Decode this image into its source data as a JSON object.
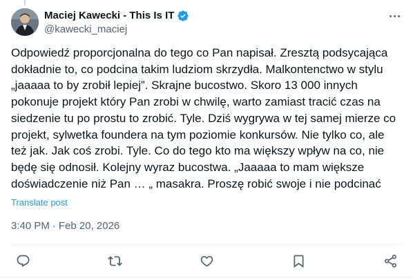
{
  "author": {
    "display_name": "Maciej Kawecki - This Is IT",
    "handle": "@kawecki_maciej",
    "verified": true
  },
  "post": {
    "text": "Odpowiedź proporcjonalna do tego co Pan napisał. Zresztą podsycająca dokładnie to, co podcina takim ludziom skrzydła. Malkontenctwo w stylu „jaaaaa to by zrobił lepiej”. Skrajne bucostwo.  Skoro 13 000 innych pokonuje projekt który Pan zrobi w chwilę, warto zamiast tracić czas na siedzenie tu po prostu to zrobić. Tyle. Dziś wygrywa w tej samej mierze co projekt, sylwetka foundera na tym poziomie konkursów. Nie tylko co, ale też jak. Jak coś zrobi. Tyle. Co do tego kto ma większy wpływ na co, nie będę się odnosił. Kolejny wyraz bucostwa. „Jaaaaa to mam większe doświadczenie niż Pan … „ masakra. Proszę robić swoje i nie podcinać",
    "translate_label": "Translate post",
    "time": "3:40 PM",
    "separator": "·",
    "date": "Feb 20, 2026"
  },
  "icons": {
    "more": "more-icon",
    "verified": "verified-badge-icon",
    "reply": "reply-icon",
    "repost": "repost-icon",
    "like": "like-icon",
    "bookmark": "bookmark-icon",
    "share": "share-icon"
  },
  "colors": {
    "text": "#0f1419",
    "secondary": "#536471",
    "link": "#1d9bf0",
    "divider": "#eff3f4"
  }
}
